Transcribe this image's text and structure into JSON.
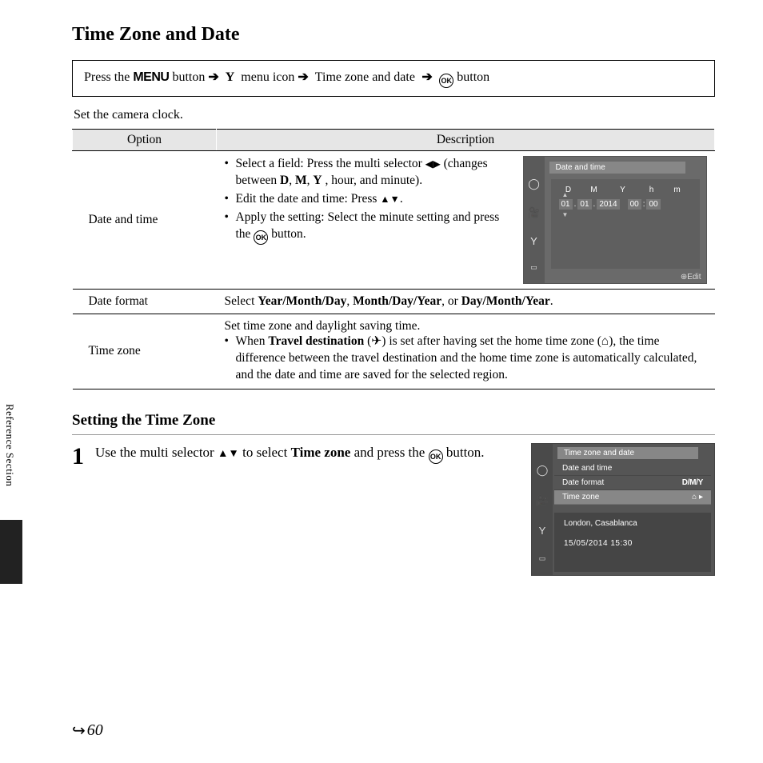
{
  "title": "Time Zone and Date",
  "nav": {
    "prefix": "Press the ",
    "menu_label": "MENU",
    "mid1": " button ",
    "wrench": "🔧",
    "mid2": " menu icon ",
    "item": "Time zone and date",
    "ok_label": "OK",
    "suffix": " button"
  },
  "intro": "Set the camera clock.",
  "table": {
    "head_option": "Option",
    "head_desc": "Description",
    "row1": {
      "name": "Date and time",
      "b1a": "Select a field: Press the multi selector ",
      "b1b": " (changes between ",
      "d": "D",
      "m": "M",
      "y": "Y",
      "b1c": ", hour, and minute).",
      "b2": "Edit the date and time: Press ",
      "b3a": "Apply the setting: Select the minute setting and press the ",
      "b3b": " button."
    },
    "row2": {
      "name": "Date format",
      "pre": "Select ",
      "o1": "Year/Month/Day",
      "o2": "Month/Day/Year",
      "o3": "Day/Month/Year"
    },
    "row3": {
      "name": "Time zone",
      "line1": "Set time zone and daylight saving time.",
      "b1a": "When ",
      "travel": "Travel destination",
      "b1b": " (",
      "plane": "✈",
      "b1c": ") is set after having set the home time zone (",
      "home": "⌂",
      "b1d": "), the time difference between the travel destination and the home time zone is automatically calculated, and the date and time are saved for the selected region."
    }
  },
  "cam1": {
    "title": "Date and time",
    "D": "D",
    "M": "M",
    "Y": "Y",
    "h": "h",
    "m": "m",
    "v_d": "01",
    "v_m": "01",
    "v_y": "2014",
    "v_hh": "00",
    "v_mm": "00",
    "edit": "Edit"
  },
  "subheading": "Setting the Time Zone",
  "step1": {
    "num": "1",
    "t1": "Use the multi selector ",
    "t2": " to select ",
    "bold": "Time zone",
    "t3": " and press the ",
    "t4": " button."
  },
  "cam2": {
    "title": "Time zone and date",
    "r1": "Date and time",
    "r2": "Date format",
    "r2v": "D/M/Y",
    "r3": "Time zone",
    "home": "⌂",
    "loc": "London, Casablanca",
    "dt": "15/05/2014  15:30"
  },
  "side_tab": "Reference Section",
  "page_num": "60"
}
